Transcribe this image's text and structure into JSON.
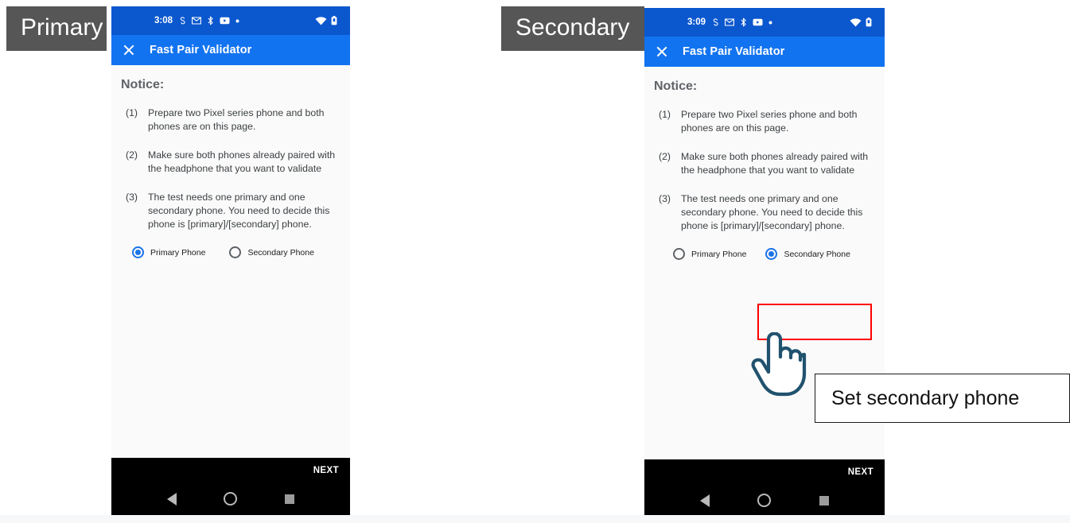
{
  "panels": [
    {
      "label": "Primary",
      "status_bar": {
        "time": "3:08",
        "icons": [
          "wallet-icon",
          "gmail-icon",
          "bluetooth-share-icon",
          "youtube-icon",
          "dot-icon"
        ],
        "right_icons": [
          "wifi-icon",
          "battery-icon"
        ]
      },
      "app_bar": {
        "close_icon": "close-icon",
        "title": "Fast Pair Validator"
      },
      "content": {
        "notice_heading": "Notice:",
        "steps": [
          {
            "num": "(1)",
            "text": "Prepare two Pixel series phone and both phones are on this page."
          },
          {
            "num": "(2)",
            "text": "Make sure both phones already paired with the headphone that you want to validate"
          },
          {
            "num": "(3)",
            "text": "The test needs one primary and one secondary phone. You need to decide this phone is [primary]/[secondary] phone."
          }
        ],
        "radio_options": [
          {
            "label": "Primary Phone",
            "selected": true
          },
          {
            "label": "Secondary Phone",
            "selected": false
          }
        ]
      },
      "nav_bar": {
        "next_label": "NEXT",
        "buttons": [
          "back-icon",
          "home-icon",
          "recents-icon"
        ]
      }
    },
    {
      "label": "Secondary",
      "status_bar": {
        "time": "3:09",
        "icons": [
          "wallet-icon",
          "gmail-icon",
          "bluetooth-share-icon",
          "youtube-icon",
          "dot-icon"
        ],
        "right_icons": [
          "wifi-icon",
          "battery-icon"
        ]
      },
      "app_bar": {
        "close_icon": "close-icon",
        "title": "Fast Pair Validator"
      },
      "content": {
        "notice_heading": "Notice:",
        "steps": [
          {
            "num": "(1)",
            "text": "Prepare two Pixel series phone and both phones are on this page."
          },
          {
            "num": "(2)",
            "text": "Make sure both phones already paired with the headphone that you want to validate"
          },
          {
            "num": "(3)",
            "text": "The test needs one primary and one secondary phone. You need to decide this phone is [primary]/[secondary] phone."
          }
        ],
        "radio_options": [
          {
            "label": "Primary Phone",
            "selected": false
          },
          {
            "label": "Secondary Phone",
            "selected": true
          }
        ]
      },
      "nav_bar": {
        "next_label": "NEXT",
        "buttons": [
          "back-icon",
          "home-icon",
          "recents-icon"
        ]
      }
    }
  ],
  "annotation": {
    "callout_text": "Set secondary phone",
    "cursor_icon": "pointing-hand-cursor",
    "highlight_color": "#ff0000",
    "callout_border_color": "#1a1a1a"
  },
  "colors": {
    "status_bar": "#0b57ce",
    "app_bar": "#1273f0",
    "accent": "#1a73e8",
    "label_chip": "#565656",
    "nav_bar": "#000000",
    "content_bg": "#fafafa"
  }
}
